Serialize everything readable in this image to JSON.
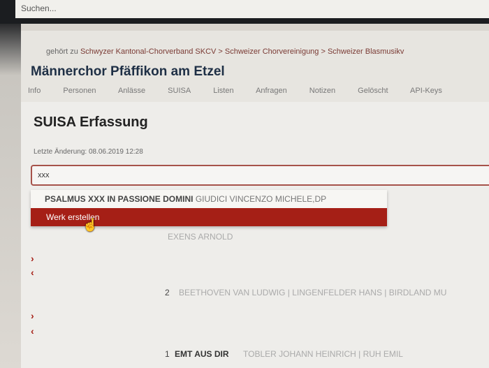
{
  "search": {
    "placeholder": "Suchen..."
  },
  "breadcrumb": {
    "prefix": "gehört zu",
    "path": "Schwyzer Kantonal-Chorverband SKCV > Schweizer Chorvereinigung > Schweizer Blasmusikv"
  },
  "org_title": "Männerchor Pfäffikon am Etzel",
  "tabs": [
    "Info",
    "Personen",
    "Anlässe",
    "SUISA",
    "Listen",
    "Anfragen",
    "Notizen",
    "Gelöscht",
    "API-Keys"
  ],
  "card": {
    "title": "SUISA Erfassung",
    "last_change": "Letzte Änderung: 08.06.2019 12:28"
  },
  "work_search": {
    "value": "xxx"
  },
  "dropdown": {
    "option": {
      "title": "PSALMUS XXX IN PASSIONE DOMINI",
      "composer": "GIUDICI VINCENZO MICHELE,DP"
    },
    "create_label": "Werk erstellen"
  },
  "entries": [
    {
      "number": "",
      "title": "",
      "composers": "EXENS ARNOLD"
    },
    {
      "number": "2",
      "title": "",
      "composers": "BEETHOVEN VAN LUDWIG | LINGENFELDER HANS | BIRDLAND MU"
    },
    {
      "number": "1",
      "title": "EMT AUS DIR",
      "composers": "TOBLER JOHANN HEINRICH | RUH EMIL"
    }
  ],
  "arrows": {
    "right": "›",
    "left": "‹"
  }
}
